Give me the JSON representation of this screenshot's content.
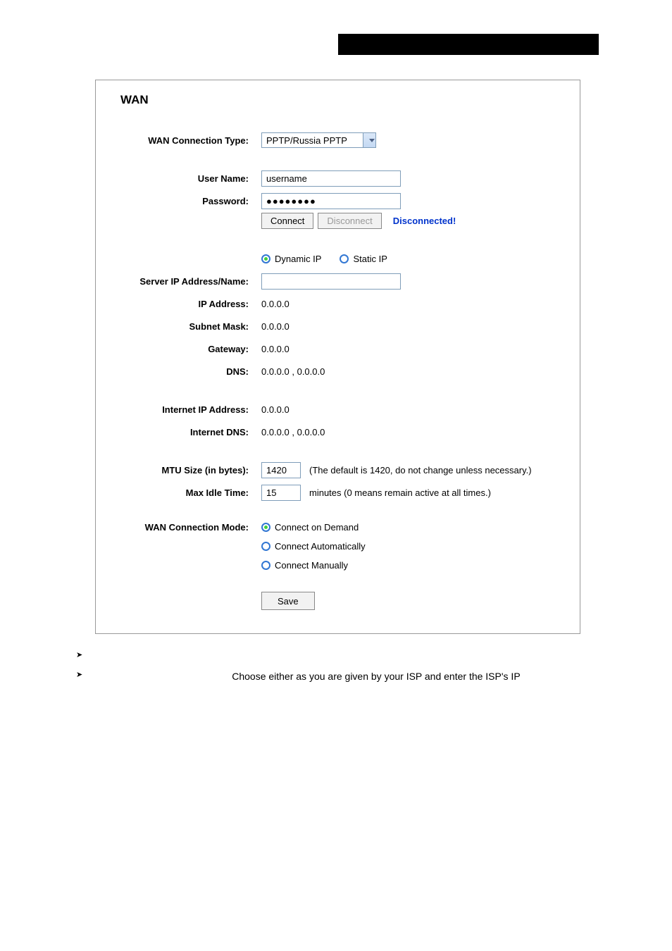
{
  "panel": {
    "title": "WAN"
  },
  "wanType": {
    "label": "WAN Connection Type:",
    "value": "PPTP/Russia PPTP"
  },
  "userName": {
    "label": "User Name:",
    "value": "username"
  },
  "password": {
    "label": "Password:",
    "value": "●●●●●●●●"
  },
  "conn": {
    "connect": "Connect",
    "disconnect": "Disconnect",
    "status": "Disconnected!"
  },
  "ipMode": {
    "dynamic": "Dynamic IP",
    "static": "Static IP"
  },
  "serverIp": {
    "label": "Server IP Address/Name:",
    "value": ""
  },
  "ipAddress": {
    "label": "IP Address:",
    "value": "0.0.0.0"
  },
  "subnetMask": {
    "label": "Subnet Mask:",
    "value": "0.0.0.0"
  },
  "gateway": {
    "label": "Gateway:",
    "value": "0.0.0.0"
  },
  "dns": {
    "label": "DNS:",
    "value": "0.0.0.0 , 0.0.0.0"
  },
  "internetIp": {
    "label": "Internet IP Address:",
    "value": "0.0.0.0"
  },
  "internetDns": {
    "label": "Internet DNS:",
    "value": "0.0.0.0 , 0.0.0.0"
  },
  "mtu": {
    "label": "MTU Size (in bytes):",
    "value": "1420",
    "hint": "(The default is 1420, do not change unless necessary.)"
  },
  "maxIdle": {
    "label": "Max Idle Time:",
    "value": "15",
    "hint": "minutes (0 means remain active at all times.)"
  },
  "wanMode": {
    "label": "WAN Connection Mode:",
    "opt1": "Connect on Demand",
    "opt2": "Connect Automatically",
    "opt3": "Connect Manually"
  },
  "save": "Save",
  "bodyText": "Choose either as you are given by your ISP and enter the ISP's IP"
}
